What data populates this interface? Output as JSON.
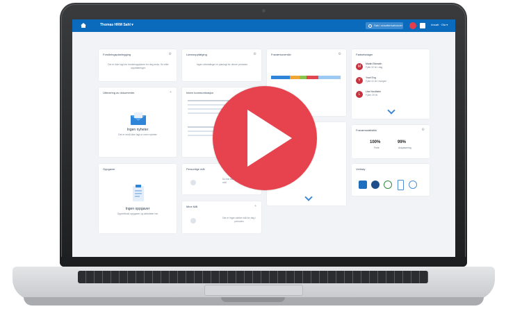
{
  "header": {
    "title": "Thomas HRM Sahl ▾",
    "search_placeholder": "Søk i ansatte/søknader",
    "user": "Ansatt · Ola ▾"
  },
  "cards": {
    "c1": {
      "title": "Forsikringsplanlegging",
      "text": "Det er ikke lagt inn forsikringsplaner for deg enda. Se etter oppdateringer."
    },
    "c2": {
      "title": "Lønnsoppfølging",
      "text": "Ingen utbetalinger er planlagt for denne perioden."
    },
    "c3": {
      "title": "Fraværsoversikt"
    },
    "c4": {
      "title": "Fødselsdager",
      "items": [
        {
          "initial": "M",
          "name": "Martin Eikeseth",
          "sub": "Fylte 32 år i dag"
        },
        {
          "initial": "Y",
          "name": "Yrsel Eng",
          "sub": "Fylte 41 år i morgen"
        },
        {
          "initial": "L",
          "name": "Line Nordheim",
          "sub": "Fyller 29 år"
        }
      ]
    },
    "c5": {
      "title": "Utlevering av dokumenter",
      "empty": "Ingen nyheter",
      "empty_sub": "Det er ennå ikke lagt ut noen nyheter"
    },
    "c6": {
      "title": "Intern kommunikasjon"
    },
    "c7": {
      "title": "Fraværsstatistikk",
      "stat1": "100%",
      "stat1_label": "Ferie",
      "stat2": "99%",
      "stat2_label": "Avspasering"
    },
    "c8": {
      "title": "Oppgaver",
      "empty": "Ingen oppgaver",
      "empty_sub": "Oppretthold oppgaver og aktiviteter her"
    },
    "c9": {
      "title": "Personlige mål",
      "text": "Du har ikke satt noen personlige mål"
    },
    "c10": {
      "title": "Verktøy"
    },
    "c11": {
      "title": "Mine Mål",
      "text": "Det er ingen aktive mål for deg i perioden"
    }
  },
  "colors": {
    "accent": "#0a6bbd",
    "play": "#e6434f",
    "avatar": "#c7313d"
  }
}
